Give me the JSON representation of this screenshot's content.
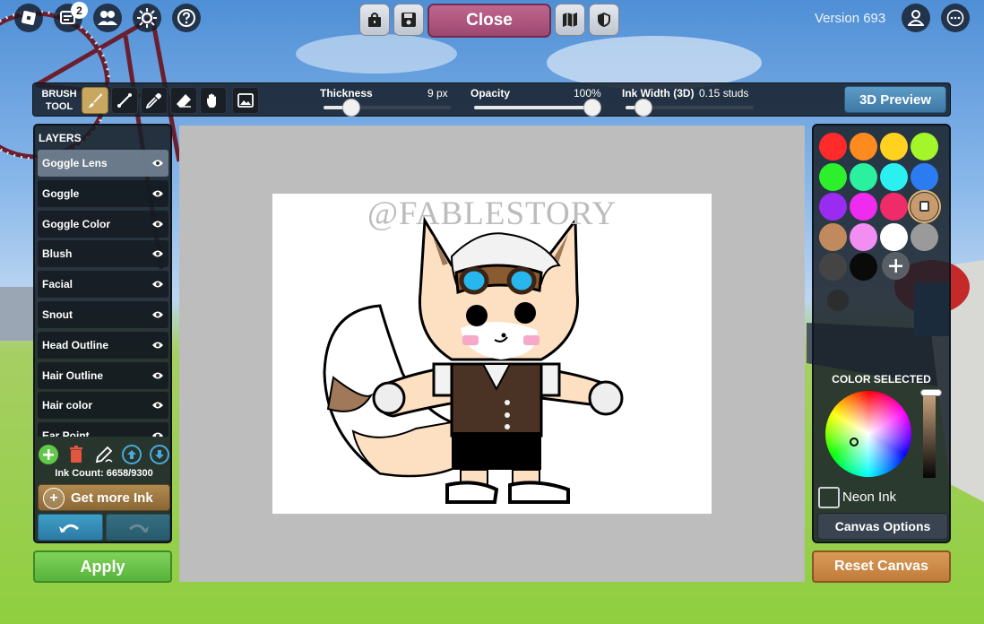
{
  "topbar": {
    "chat_badge_count": "2",
    "close_label": "Close",
    "version_label": "Version 693"
  },
  "brush_tool": {
    "title_line1": "BRUSH",
    "title_line2": "TOOL",
    "tools": [
      "brush-icon",
      "line-icon",
      "eyedropper-icon",
      "eraser-icon",
      "hand-icon",
      "image-icon"
    ],
    "active_tool": "brush-icon",
    "thickness": {
      "label": "Thickness",
      "value": "9 px",
      "level": 0.1
    },
    "opacity": {
      "label": "Opacity",
      "value": "100%",
      "level": 1.0
    },
    "ink_width": {
      "label": "Ink Width (3D)",
      "value": "0.15 studs",
      "level": 0.1
    },
    "preview_label": "3D Preview"
  },
  "layers": {
    "title": "LAYERS",
    "items": [
      {
        "label": "Goggle Lens",
        "active": true
      },
      {
        "label": "Goggle",
        "active": false
      },
      {
        "label": "Goggle Color",
        "active": false
      },
      {
        "label": "Blush",
        "active": false
      },
      {
        "label": "Facial",
        "active": false
      },
      {
        "label": "Snout",
        "active": false
      },
      {
        "label": "Head Outline",
        "active": false
      },
      {
        "label": "Hair Outline",
        "active": false
      },
      {
        "label": "Hair color",
        "active": false
      },
      {
        "label": "Ear Point",
        "active": false
      }
    ],
    "ink_count": "Ink Count: 6658/9300",
    "get_ink_label": "Get more Ink",
    "apply_label": "Apply"
  },
  "canvas": {
    "watermark": "@FABLESTORY"
  },
  "palette": {
    "swatches": [
      "#ff2a2a",
      "#ff8a1f",
      "#ffd21f",
      "#a4f52a",
      "#2bf02b",
      "#2bf0a0",
      "#2bf0f0",
      "#2b7cf0",
      "#9a2bf0",
      "#f02bf0",
      "#f02b6a",
      "#c89a6e",
      "#c08a5e",
      "#f28df2",
      "#ffffff",
      "#9a9a9a",
      "#444444",
      "#0a0a0a"
    ],
    "selected_swatch": "#c89a6e",
    "selected_label": "COLOR SELECTED",
    "neon_label": "Neon Ink",
    "canvas_options_label": "Canvas Options",
    "reset_label": "Reset Canvas"
  }
}
